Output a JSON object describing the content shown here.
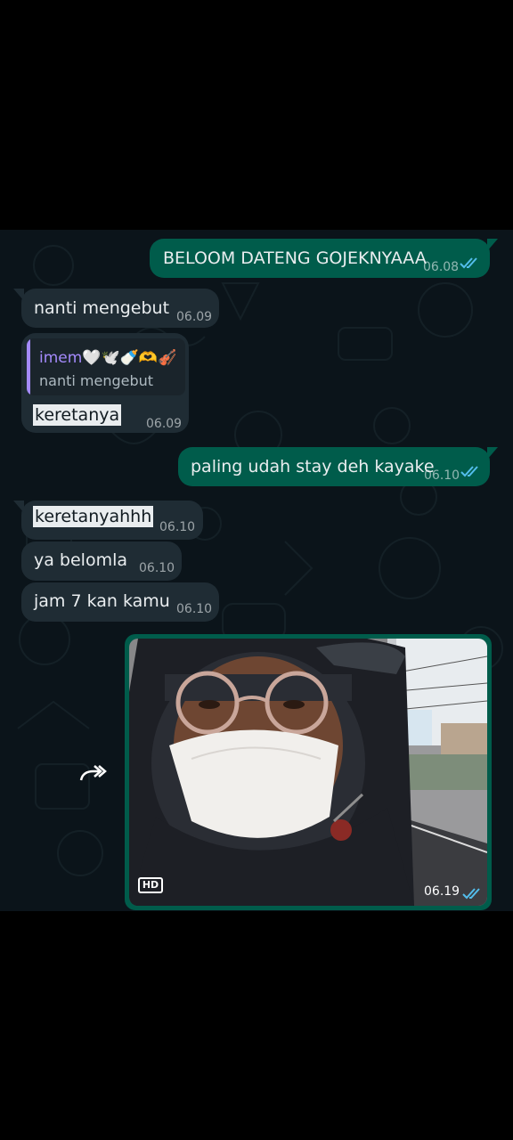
{
  "messages": [
    {
      "dir": "out",
      "text": "BELOOM DATENG GOJEKNYAAA",
      "time": "06.08"
    },
    {
      "dir": "in",
      "text": "nanti mengebut",
      "time": "06.09"
    },
    {
      "dir": "in",
      "quote": {
        "author": "imem🤍🕊️🍼🫶🎻",
        "text": "nanti mengebut"
      },
      "text": "keretanya",
      "time": "06.09"
    },
    {
      "dir": "out",
      "text": "paling udah stay deh kayake",
      "time": "06.10"
    },
    {
      "dir": "in",
      "text": "keretanyahhh",
      "time": "06.10"
    },
    {
      "dir": "in",
      "text": "ya belomla",
      "time": "06.10"
    },
    {
      "dir": "in",
      "text": "jam 7 kan kamu",
      "time": "06.10"
    }
  ],
  "photo_message": {
    "dir": "out",
    "badge": "HD",
    "time": "06.19"
  },
  "icons": {
    "read_receipt": "double-check-icon",
    "forward": "forward-arrow-icon",
    "hd": "hd-badge-icon"
  },
  "colors": {
    "outgoing_bubble": "#005c4b",
    "incoming_bubble": "#1f2c34",
    "background": "#0b141a",
    "read_ticks": "#53bdeb",
    "quote_accent": "#a48afc"
  }
}
